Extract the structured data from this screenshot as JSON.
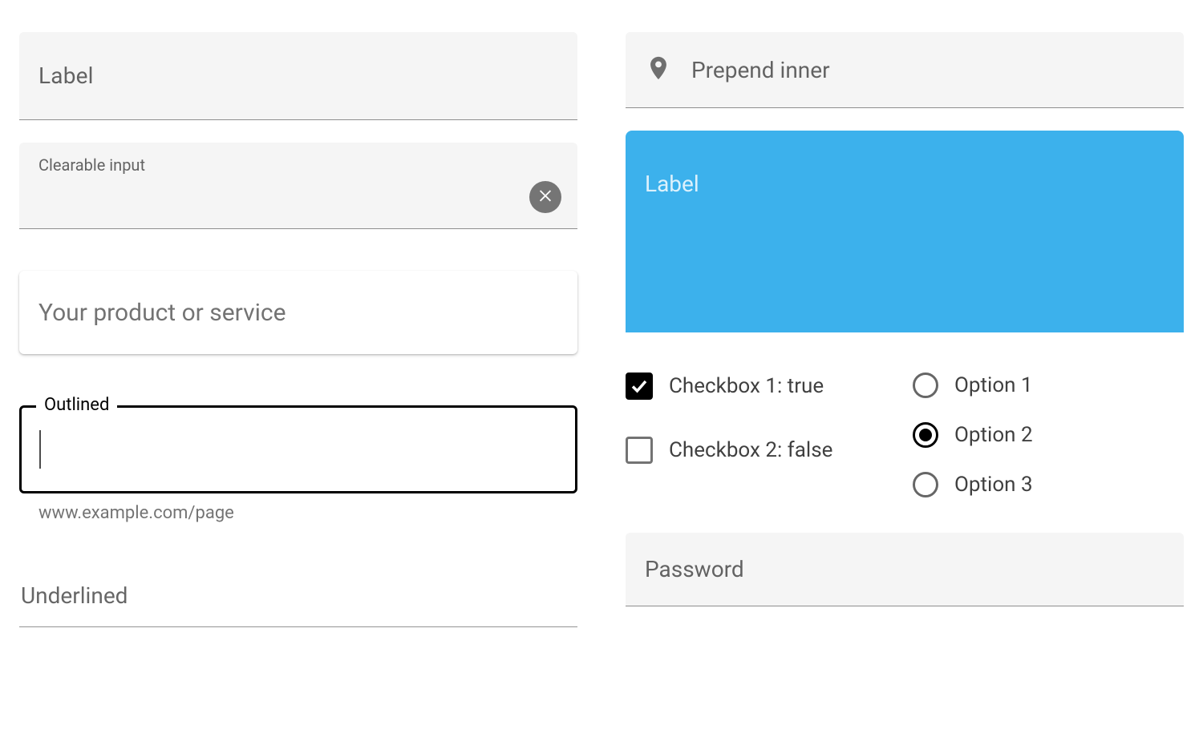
{
  "left": {
    "field1": {
      "label": "Label"
    },
    "field2": {
      "label": "Clearable input",
      "value": ""
    },
    "field3": {
      "label": "Your product or service"
    },
    "field4": {
      "label": "Outlined",
      "hint": "www.example.com/page",
      "value": ""
    },
    "field5": {
      "label": "Underlined"
    }
  },
  "right": {
    "prepend": {
      "label": "Prepend inner",
      "icon": "map-pin-icon"
    },
    "blue": {
      "label": "Label"
    },
    "checkboxes": [
      {
        "label": "Checkbox 1: true",
        "checked": true
      },
      {
        "label": "Checkbox 2: false",
        "checked": false
      }
    ],
    "radios": {
      "selected_index": 1,
      "options": [
        {
          "label": "Option 1"
        },
        {
          "label": "Option 2"
        },
        {
          "label": "Option 3"
        }
      ]
    },
    "password": {
      "label": "Password"
    }
  },
  "colors": {
    "blue": "#3cb1ec",
    "filled_bg": "#f5f5f5"
  }
}
